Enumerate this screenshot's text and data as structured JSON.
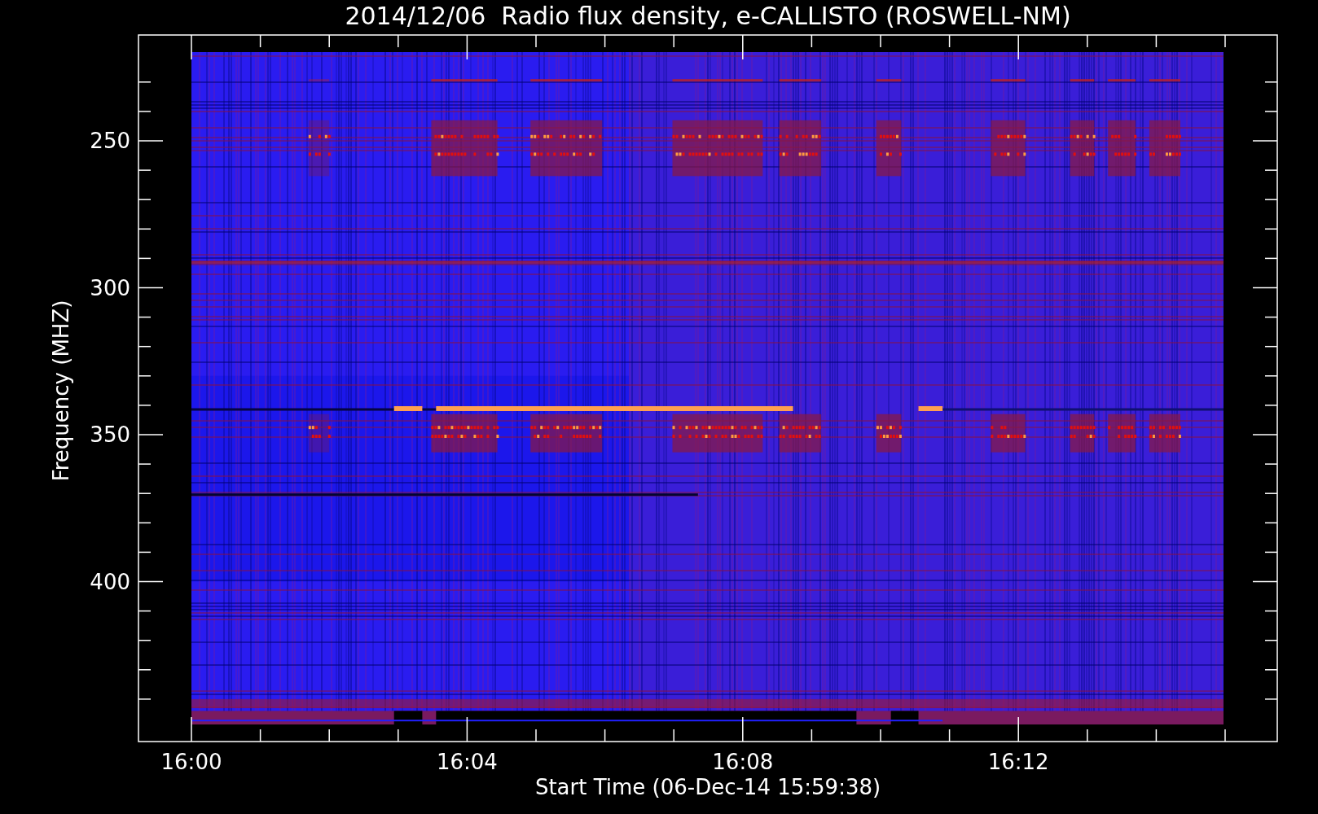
{
  "chart": {
    "title": "2014/12/06  Radio flux density, e-CALLISTO (ROSWELL-NM)",
    "ylabel": "Frequency (MHZ)",
    "xlabel": "Start Time (06-Dec-14 15:59:38)",
    "yticks": [
      "250",
      "300",
      "350",
      "400"
    ],
    "xticks": [
      "16:00",
      "16:04",
      "16:08",
      "16:12"
    ]
  }
}
